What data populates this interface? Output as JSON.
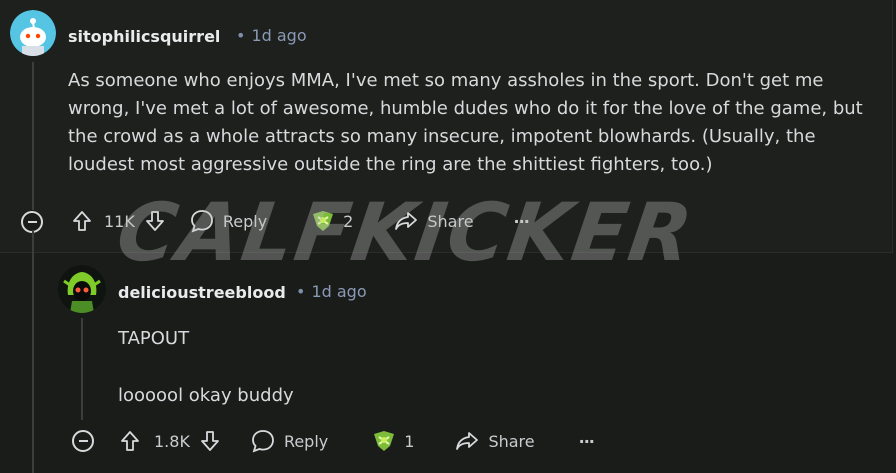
{
  "comments": [
    {
      "author": "sitophilicsquirrel",
      "time": "1d ago",
      "body": "As someone who enjoys MMA, I've met so many assholes in the sport. Don't get me wrong, I've met a lot of awesome, humble dudes who do it for the love of the game, but the crowd as a whole attracts so many insecure, impotent blowhards. (Usually, the loudest most aggressive outside the ring are the shittiest fighters, too.)",
      "votes": "11K",
      "reply_label": "Reply",
      "award_count": "2",
      "share_label": "Share",
      "more_label": "···"
    },
    {
      "author": "delicioustreeblood",
      "time": "1d ago",
      "body_lines": [
        "TAPOUT",
        "loooool okay buddy"
      ],
      "votes": "1.8K",
      "reply_label": "Reply",
      "award_count": "1",
      "share_label": "Share",
      "more_label": "···"
    }
  ],
  "watermark": "CALFKICKER",
  "icons": {
    "collapse": "collapse-minus-icon",
    "upvote": "upvote-arrow-icon",
    "downvote": "downvote-arrow-icon",
    "reply": "speech-bubble-icon",
    "award": "award-icon",
    "share": "share-arrow-icon"
  },
  "colors": {
    "background": "#1a1c1a",
    "meta_text": "#8a99b5",
    "award_green": "#7dbb3a"
  }
}
